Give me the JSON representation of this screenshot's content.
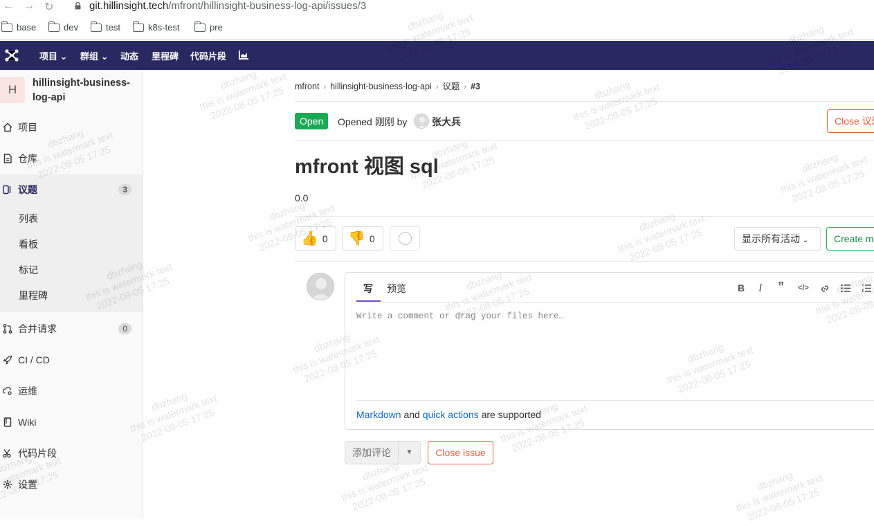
{
  "browser": {
    "url_host": "git.hillinsight.tech",
    "url_path": "/mfront/hillinsight-business-log-api/issues/3",
    "bookmarks": [
      "base",
      "dev",
      "test",
      "k8s-test",
      "pre"
    ]
  },
  "topnav": {
    "items": [
      "项目",
      "群组",
      "动态",
      "里程碑",
      "代码片段"
    ],
    "bg_color": "#292961"
  },
  "sidebar": {
    "project_initial": "H",
    "project_name": "hillinsight-business-log-api",
    "items": [
      {
        "label": "项目",
        "icon": "home-icon"
      },
      {
        "label": "仓库",
        "icon": "document-icon"
      },
      {
        "label": "议题",
        "icon": "issues-icon",
        "badge": "3"
      },
      {
        "label": "合并请求",
        "icon": "merge-request-icon",
        "badge": "0"
      },
      {
        "label": "CI / CD",
        "icon": "rocket-icon"
      },
      {
        "label": "运维",
        "icon": "cloud-gear-icon"
      },
      {
        "label": "Wiki",
        "icon": "book-icon"
      },
      {
        "label": "代码片段",
        "icon": "scissors-icon"
      },
      {
        "label": "设置",
        "icon": "settings-icon"
      }
    ],
    "sub_items": [
      "列表",
      "看板",
      "标记",
      "里程碑"
    ]
  },
  "breadcrumb": [
    "mfront",
    "hillinsight-business-log-api",
    "议题",
    "#3"
  ],
  "issue": {
    "status": "Open",
    "opened_text": "Opened 刚刚 by",
    "author": "张大兵",
    "close_top": "Close 议题",
    "title": "mfront 视图 sql",
    "description": "0.0",
    "thumbs_up": "0",
    "thumbs_down": "0",
    "activity_filter": "显示所有活动",
    "create_mr": "Create merge request"
  },
  "comment": {
    "tab_write": "写",
    "tab_preview": "预览",
    "placeholder": "Write a comment or drag your files here…",
    "md_link": "Markdown",
    "md_and": "and",
    "qa_link": "quick actions",
    "md_suffix": "are supported",
    "add_comment": "添加评论",
    "close_issue": "Close issue"
  },
  "watermark": {
    "user": "dbzhang",
    "text": "this is watermark text",
    "time": "2022-08-05 17:25"
  }
}
